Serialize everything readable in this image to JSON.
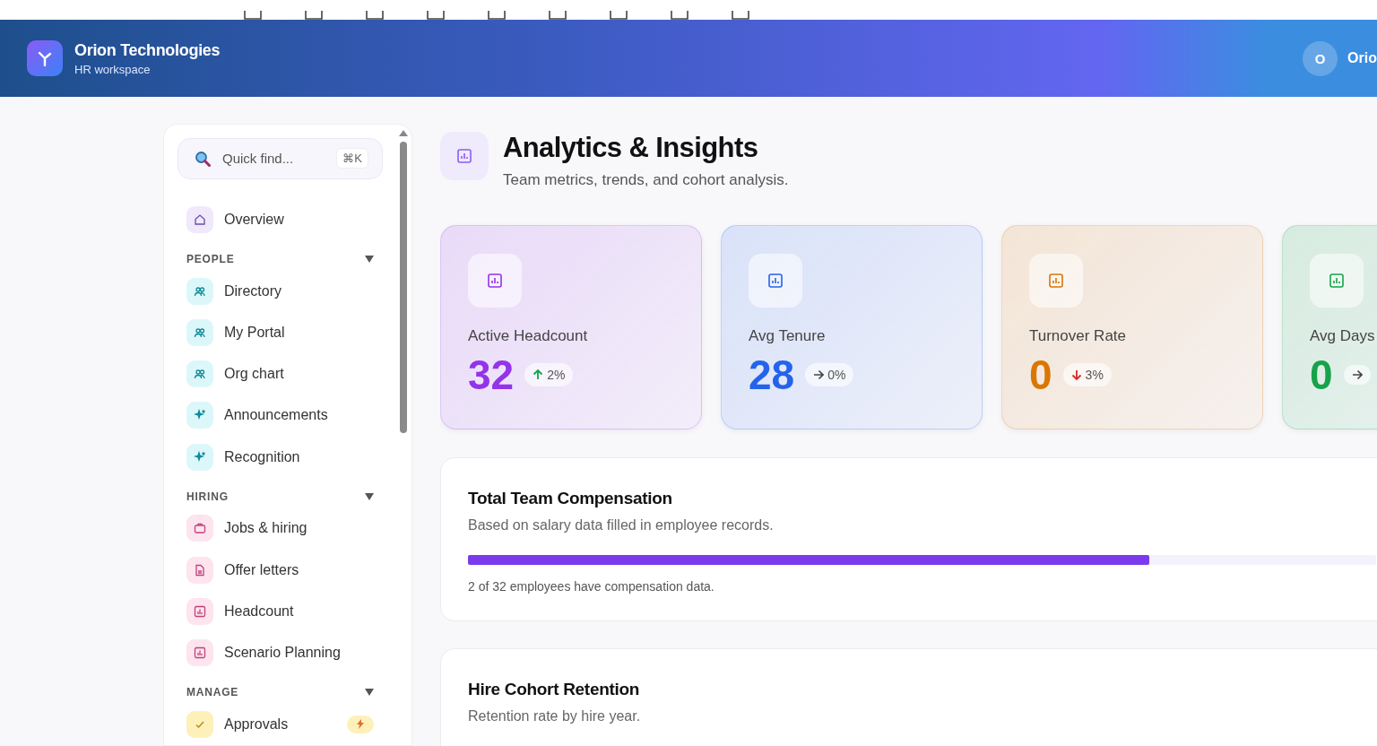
{
  "header": {
    "company": "Orion Technologies",
    "subtitle": "HR workspace",
    "user": {
      "initial": "O",
      "name": "Orio"
    }
  },
  "sidebar": {
    "search": {
      "placeholder": "Quick find...",
      "shortcut": "⌘K"
    },
    "top_item": {
      "label": "Overview",
      "kind": "home",
      "selected": false
    },
    "sections": [
      {
        "title": "PEOPLE",
        "kind": "people",
        "expanded": true,
        "items": [
          {
            "label": "Directory",
            "kind": "users"
          },
          {
            "label": "My Portal",
            "kind": "users"
          },
          {
            "label": "Org chart",
            "kind": "users"
          },
          {
            "label": "Announcements",
            "kind": "sparkle"
          },
          {
            "label": "Recognition",
            "kind": "sparkle"
          }
        ]
      },
      {
        "title": "HIRING",
        "kind": "hiring",
        "expanded": true,
        "items": [
          {
            "label": "Jobs & hiring",
            "kind": "briefcase"
          },
          {
            "label": "Offer letters",
            "kind": "file"
          },
          {
            "label": "Headcount",
            "kind": "chart"
          },
          {
            "label": "Scenario Planning",
            "kind": "chart"
          }
        ]
      },
      {
        "title": "MANAGE",
        "kind": "manage",
        "expanded": true,
        "items": [
          {
            "label": "Approvals",
            "kind": "check",
            "alert": true
          }
        ]
      }
    ]
  },
  "page": {
    "title": "Analytics & Insights",
    "subtitle": "Team metrics, trends, and cohort analysis."
  },
  "kpis": [
    {
      "label": "Active Headcount",
      "value": "32",
      "kind": "up",
      "change": "2%",
      "color": "#9333ea"
    },
    {
      "label": "Avg Tenure",
      "value": "28",
      "kind": "flat",
      "change": "0%",
      "color": "#2563eb"
    },
    {
      "label": "Turnover Rate",
      "value": "0",
      "kind": "down",
      "change": "3%",
      "color": "#d97706"
    },
    {
      "label": "Avg Days",
      "value": "0",
      "kind": "flat",
      "color": "#16a34a"
    }
  ],
  "compensation": {
    "title": "Total Team Compensation",
    "subtitle": "Based on salary data filled in employee records.",
    "level": 0.75,
    "note": "2 of 32 employees have compensation data."
  },
  "retention": {
    "title": "Hire Cohort Retention",
    "subtitle": "Retention rate by hire year."
  }
}
